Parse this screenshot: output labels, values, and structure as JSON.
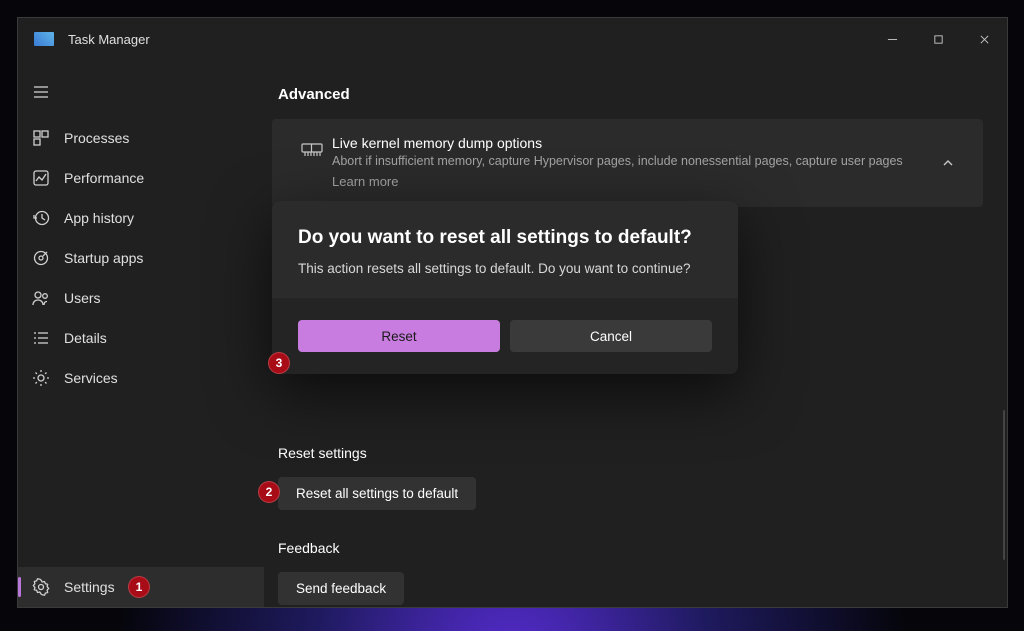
{
  "appTitle": "Task Manager",
  "nav": {
    "processes": "Processes",
    "performance": "Performance",
    "appHistory": "App history",
    "startupApps": "Startup apps",
    "users": "Users",
    "details": "Details",
    "services": "Services",
    "settings": "Settings"
  },
  "sections": {
    "advanced": "Advanced",
    "resetSettings": "Reset settings",
    "feedback": "Feedback"
  },
  "kernelCard": {
    "title": "Live kernel memory dump options",
    "desc": "Abort if insufficient memory, capture Hypervisor pages, include nonessential pages, capture user pages",
    "learnMore": "Learn more"
  },
  "buttons": {
    "resetAll": "Reset all settings to default",
    "sendFeedback": "Send feedback"
  },
  "dialog": {
    "title": "Do you want to reset all settings to default?",
    "message": "This action resets all settings to default. Do you want to continue?",
    "reset": "Reset",
    "cancel": "Cancel"
  },
  "annotations": {
    "b1": "1",
    "b2": "2",
    "b3": "3"
  }
}
